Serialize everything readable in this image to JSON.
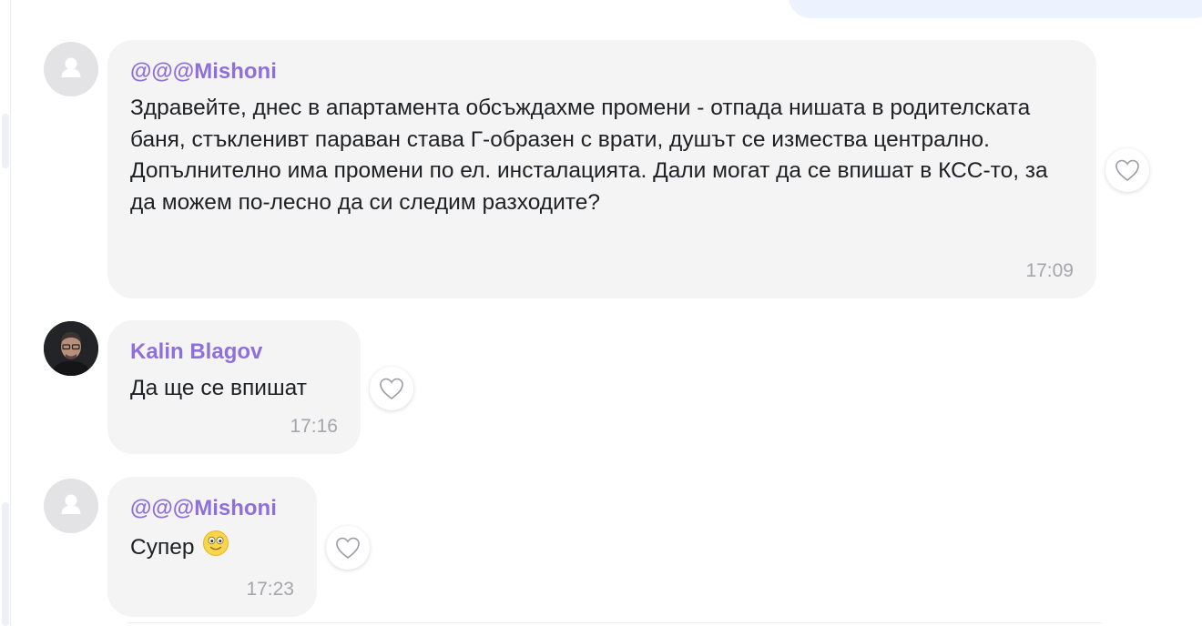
{
  "colors": {
    "author_name": "#8f6fdc",
    "bubble_background": "#f4f4f5",
    "own_bubble_background": "#edf3fe",
    "timestamp": "#a5a5ab"
  },
  "messages": [
    {
      "author": "@@@Mishoni",
      "avatar": "default-user-avatar",
      "text": "Здравейте, днес в апартамента обсъждахме промени - отпада нишата в родителската баня, стъкленивт параван става Г-образен с врати, душът се измества централно. Допълнително има промени по ел. инсталацията. Дали могат да се впишат в КСС-то, за да можем по-лесно да си следим разходите?",
      "time": "17:09",
      "reaction_icon": "heart-outline-icon"
    },
    {
      "author": "Kalin Blagov",
      "avatar": "user-photo-avatar",
      "text": "Да ще се впишат",
      "time": "17:16",
      "reaction_icon": "heart-outline-icon"
    },
    {
      "author": "@@@Mishoni",
      "avatar": "default-user-avatar",
      "text": "Супер",
      "emoji": "smiling-face-emoji",
      "time": "17:23",
      "reaction_icon": "heart-outline-icon"
    }
  ]
}
